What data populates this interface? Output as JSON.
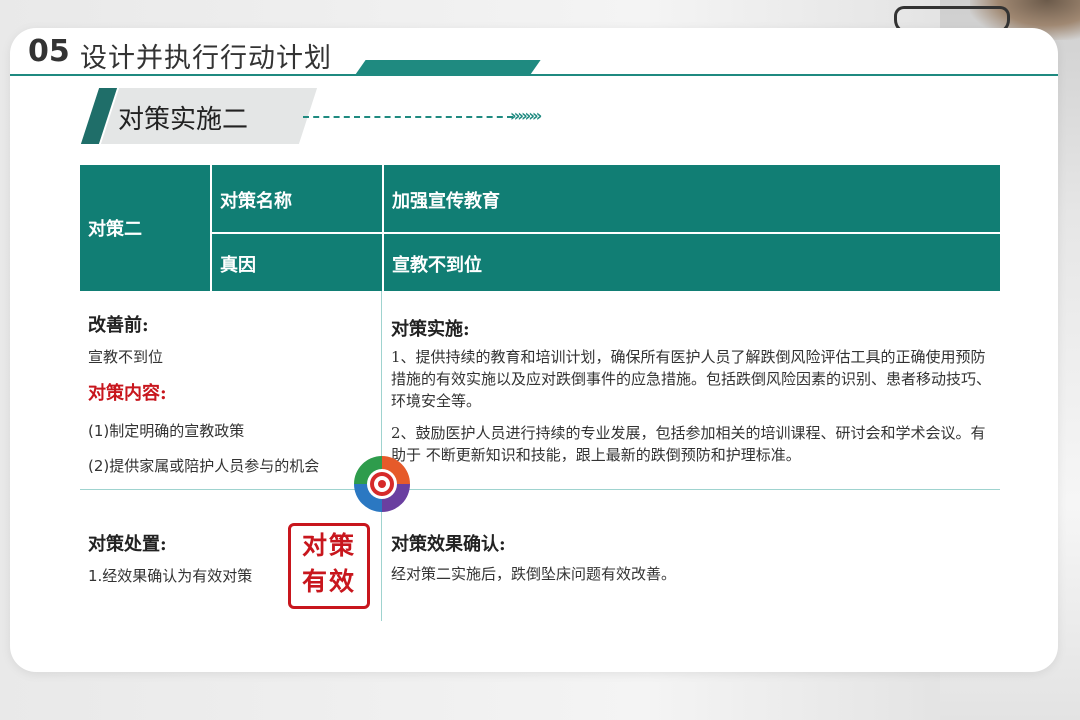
{
  "header": {
    "number": "05",
    "title": "设计并执行行动计划"
  },
  "subheader": {
    "title": "对策实施二",
    "arrows": "»»»»"
  },
  "table": {
    "row_label": "对策二",
    "name_label": "对策名称",
    "name_value": "加强宣传教育",
    "cause_label": "真因",
    "cause_value": "宣教不到位"
  },
  "before": {
    "heading": "改善前:",
    "text": "宣教不到位",
    "content_heading": "对策内容:",
    "items": [
      "(1)制定明确的宣教政策",
      "(2)提供家属或陪护人员参与的机会"
    ]
  },
  "implementation": {
    "heading": "对策实施:",
    "paragraphs": [
      "1、提供持续的教育和培训计划，确保所有医护人员了解跌倒风险评估工具的正确使用预防措施的有效实施以及应对跌倒事件的应急措施。包括跌倒风险因素的识别、患者移动技巧、环境安全等。",
      "2、鼓励医护人员进行持续的专业发展，包括参加相关的培训课程、研讨会和学术会议。有助于 不断更新知识和技能，跟上最新的跌倒预防和护理标准。"
    ]
  },
  "disposal": {
    "heading": "对策处置:",
    "text": "1.经效果确认为有效对策"
  },
  "stamp": {
    "line1": "对策",
    "line2": "有效"
  },
  "effect": {
    "heading": "对策效果确认:",
    "text": "经对策二实施后，跌倒坠床问题有效改善。"
  },
  "colors": {
    "teal": "#117e74",
    "red": "#c8161d"
  },
  "icons": [
    "pdca-cycle-icon"
  ]
}
